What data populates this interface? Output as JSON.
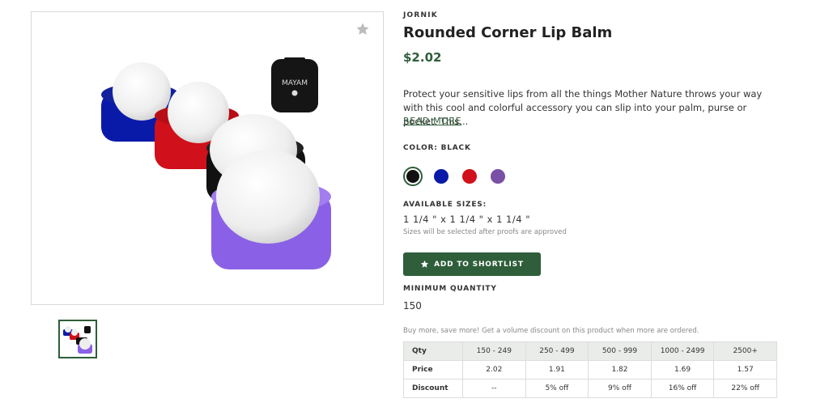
{
  "product": {
    "brand": "JORNIK",
    "title": "Rounded Corner Lip Balm",
    "price": "$2.02",
    "description": "Protect your sensitive lips from all the things Mother Nature throws your way with this cool and colorful accessory you can slip into your palm, purse or pocket. This...",
    "read_more": "READ MORE",
    "image_logo_text": "MAYAM",
    "favorite_icon": "star-icon"
  },
  "color": {
    "label": "COLOR: BLACK",
    "swatches": [
      {
        "name": "black",
        "hex": "#111111",
        "selected": true
      },
      {
        "name": "blue",
        "hex": "#0a1aa8",
        "selected": false
      },
      {
        "name": "red",
        "hex": "#d0101a",
        "selected": false
      },
      {
        "name": "purple",
        "hex": "#7a4fa6",
        "selected": false
      }
    ]
  },
  "sizes": {
    "label": "AVAILABLE SIZES:",
    "value": "1 1/4 \" x 1 1/4 \" x 1 1/4 \"",
    "note": "Sizes will be selected after proofs are approved"
  },
  "shortlist_button": {
    "label": "ADD TO SHORTLIST",
    "icon": "star-icon"
  },
  "min_quantity": {
    "label": "MINIMUM QUANTITY",
    "value": "150"
  },
  "volume_note": "Buy more, save more! Get a volume discount on this product when more are ordered.",
  "pricing_table": {
    "headers": [
      "Qty",
      "150 - 249",
      "250 - 499",
      "500 - 999",
      "1000 - 2499",
      "2500+"
    ],
    "price": [
      "Price",
      "2.02",
      "1.91",
      "1.82",
      "1.69",
      "1.57"
    ],
    "discount": [
      "Discount",
      "--",
      "5% off",
      "9% off",
      "16% off",
      "22% off"
    ]
  },
  "colors": {
    "accent": "#2e5e3a"
  }
}
